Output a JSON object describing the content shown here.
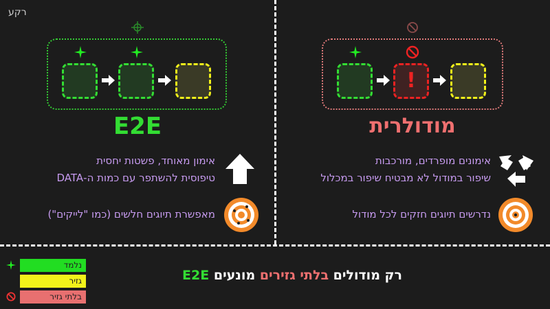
{
  "corner_label": "רקע",
  "e2e": {
    "title": "E2E",
    "line1": "אימון מאוחד, פשטות יחסית",
    "line2": "טיפוסית להשתפר עם כמות ה-DATA",
    "line3": "מאפשרת תיוגים חלשים (כמו \"לייקים\")"
  },
  "modular": {
    "title": "מודולרית",
    "line1": "אימונים מופרדים, מורכבות",
    "line2": "שיפור במודול לא מבטיח שיפור במכלול",
    "line3": "נדרשים תיוגים חזקים לכל מודול",
    "error_mark": "!"
  },
  "bottom": {
    "part1": "רק מודולים ",
    "part2": "בלתי גזירים",
    "part3": " מונעים ",
    "part4": "E2E"
  },
  "legend": [
    {
      "label": "נלמד",
      "color": "#22dd22",
      "icon": "sparkle-icon"
    },
    {
      "label": "גזיר",
      "color": "#f2f21a",
      "icon": ""
    },
    {
      "label": "בלתי גזיר",
      "color": "#e87070",
      "icon": "no-entry-icon"
    }
  ],
  "colors": {
    "learned": "#33dd33",
    "differentiable": "#f2f21a",
    "non_differentiable": "#ee2222",
    "text_accent": "#c79bf0"
  }
}
